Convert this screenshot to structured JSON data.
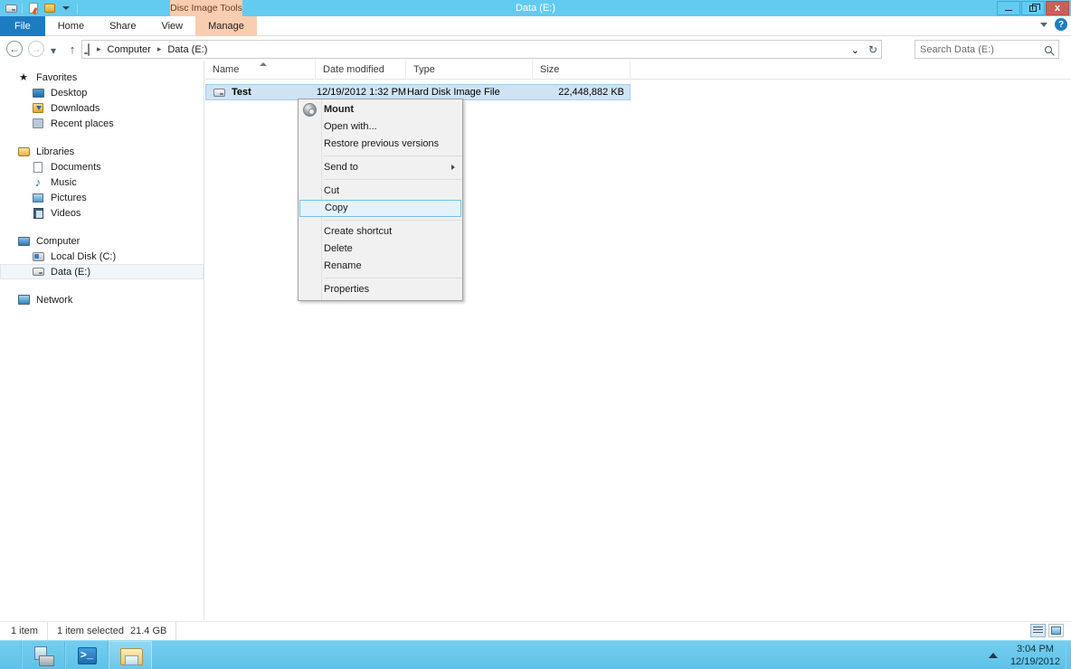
{
  "window": {
    "title": "Data (E:)",
    "controls": {
      "minimize_name": "minimize",
      "maximize_name": "restore",
      "close_label": "x"
    },
    "quick_access": [
      {
        "label": "Drive properties",
        "icon": "drive-icon"
      },
      {
        "label": "Properties",
        "icon": "properties-icon"
      },
      {
        "label": "New folder",
        "icon": "new-folder-icon"
      },
      {
        "label": "Customize Quick Access Toolbar",
        "icon": "chevron-down-icon"
      }
    ]
  },
  "ribbon": {
    "contextual_group": "Disc Image Tools",
    "tabs": [
      {
        "label": "File",
        "active": false
      },
      {
        "label": "Home",
        "active": false
      },
      {
        "label": "Share",
        "active": false
      },
      {
        "label": "View",
        "active": false
      },
      {
        "label": "Manage",
        "active": false
      }
    ],
    "collapse_icon": "chevron-down-icon",
    "help_label": "?"
  },
  "address": {
    "back_label": "←",
    "forward_label": "→",
    "recent_label": "▾",
    "up_label": "↑",
    "drive_icon": "drive-icon",
    "breadcrumbs": [
      "Computer",
      "Data (E:)"
    ],
    "separator": "▸",
    "dropdown_label": "⌄",
    "refresh_label": "↻",
    "search_placeholder": "Search Data (E:)",
    "search_value": "",
    "search_icon": "search-icon"
  },
  "sidebar": {
    "groups": [
      {
        "header": {
          "label": "Favorites",
          "icon": "star-icon"
        },
        "items": [
          {
            "label": "Desktop",
            "icon": "desktop-icon"
          },
          {
            "label": "Downloads",
            "icon": "downloads-icon"
          },
          {
            "label": "Recent places",
            "icon": "recent-places-icon"
          }
        ]
      },
      {
        "header": {
          "label": "Libraries",
          "icon": "libraries-icon"
        },
        "items": [
          {
            "label": "Documents",
            "icon": "document-icon"
          },
          {
            "label": "Music",
            "icon": "music-icon"
          },
          {
            "label": "Pictures",
            "icon": "picture-icon"
          },
          {
            "label": "Videos",
            "icon": "video-icon"
          }
        ]
      },
      {
        "header": {
          "label": "Computer",
          "icon": "computer-icon"
        },
        "items": [
          {
            "label": "Local Disk (C:)",
            "icon": "hard-disk-icon",
            "selected": false
          },
          {
            "label": "Data (E:)",
            "icon": "drive-icon",
            "selected": true
          }
        ]
      },
      {
        "header": {
          "label": "Network",
          "icon": "network-icon"
        },
        "items": []
      }
    ]
  },
  "filelist": {
    "columns": [
      {
        "label": "Name",
        "sorted": "asc"
      },
      {
        "label": "Date modified",
        "sorted": ""
      },
      {
        "label": "Type",
        "sorted": ""
      },
      {
        "label": "Size",
        "sorted": ""
      }
    ],
    "rows": [
      {
        "name": "Test",
        "date_modified": "12/19/2012 1:32 PM",
        "type": "Hard Disk Image File",
        "size": "22,448,882 KB",
        "icon": "drive-icon",
        "selected": true
      }
    ]
  },
  "context_menu": {
    "items": [
      {
        "label": "Mount",
        "bold": true,
        "icon": "disc-icon",
        "highlighted": false,
        "submenu": false
      },
      {
        "label": "Open with...",
        "bold": false,
        "highlighted": false,
        "submenu": false
      },
      {
        "label": "Restore previous versions",
        "bold": false,
        "highlighted": false,
        "submenu": false
      },
      {
        "separator": true
      },
      {
        "label": "Send to",
        "bold": false,
        "highlighted": false,
        "submenu": true
      },
      {
        "separator": true
      },
      {
        "label": "Cut",
        "bold": false,
        "highlighted": false,
        "submenu": false
      },
      {
        "label": "Copy",
        "bold": false,
        "highlighted": true,
        "submenu": false
      },
      {
        "separator": true
      },
      {
        "label": "Create shortcut",
        "bold": false,
        "highlighted": false,
        "submenu": false
      },
      {
        "label": "Delete",
        "bold": false,
        "highlighted": false,
        "submenu": false
      },
      {
        "label": "Rename",
        "bold": false,
        "highlighted": false,
        "submenu": false
      },
      {
        "separator": true
      },
      {
        "label": "Properties",
        "bold": false,
        "highlighted": false,
        "submenu": false
      }
    ]
  },
  "statusbar": {
    "item_count": "1 item",
    "selection_info": "1 item selected",
    "selection_size": "21.4 GB",
    "views": [
      {
        "name": "details-view-button",
        "active": true
      },
      {
        "name": "large-icons-view-button",
        "active": false
      }
    ]
  },
  "taskbar": {
    "buttons": [
      {
        "name": "server-manager",
        "label": "Server Manager",
        "active": false
      },
      {
        "name": "powershell",
        "label": "Windows PowerShell",
        "active": false
      },
      {
        "name": "file-explorer",
        "label": "File Explorer",
        "active": true
      }
    ],
    "tray": {
      "show_hidden_label": "▲",
      "time": "3:04 PM",
      "date": "12/19/2012"
    }
  },
  "colors": {
    "titlebar": "#63cbf0",
    "file_tab": "#1d7cc1",
    "contextual_tab": "#f8cdb0",
    "selection": "#cfe3f4",
    "menu_highlight": "#e3f2fb",
    "close_button": "#c9615b"
  }
}
